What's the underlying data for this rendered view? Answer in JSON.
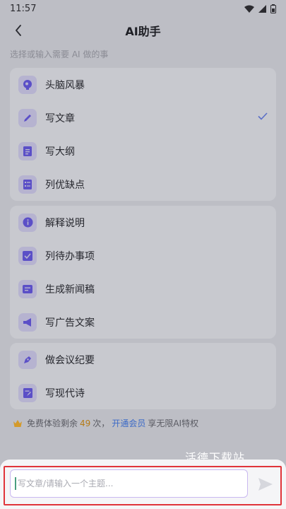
{
  "status_bar": {
    "time": "11:57"
  },
  "header": {
    "title": "AI助手"
  },
  "hint": "选择或输入需要 AI 做的事",
  "groups": [
    {
      "items": [
        {
          "label": "头脑风暴",
          "icon": "brain-icon"
        },
        {
          "label": "写文章",
          "icon": "pencil-icon",
          "selected": true
        },
        {
          "label": "写大纲",
          "icon": "document-icon"
        },
        {
          "label": "列优缺点",
          "icon": "checklist-icon"
        }
      ]
    },
    {
      "items": [
        {
          "label": "解释说明",
          "icon": "info-icon"
        },
        {
          "label": "列待办事项",
          "icon": "checkbox-icon"
        },
        {
          "label": "生成新闻稿",
          "icon": "news-icon"
        },
        {
          "label": "写广告文案",
          "icon": "megaphone-icon"
        }
      ]
    },
    {
      "items": [
        {
          "label": "做会议纪要",
          "icon": "pen-nib-icon"
        },
        {
          "label": "写现代诗",
          "icon": "poem-icon"
        }
      ]
    }
  ],
  "quota": {
    "prefix": "免费体验剩余",
    "count": "49",
    "suffix": "次，",
    "link": "开通会员",
    "tail": "享无限AI特权"
  },
  "watermark": "活德下载站",
  "input": {
    "placeholder": "写文章/请输入一个主题..."
  },
  "colors": {
    "accent": "#5b4fc7",
    "check": "#5b6fc7",
    "quota_count": "#b57b17",
    "link": "#3c6ac6",
    "highlight": "#e0343a"
  }
}
